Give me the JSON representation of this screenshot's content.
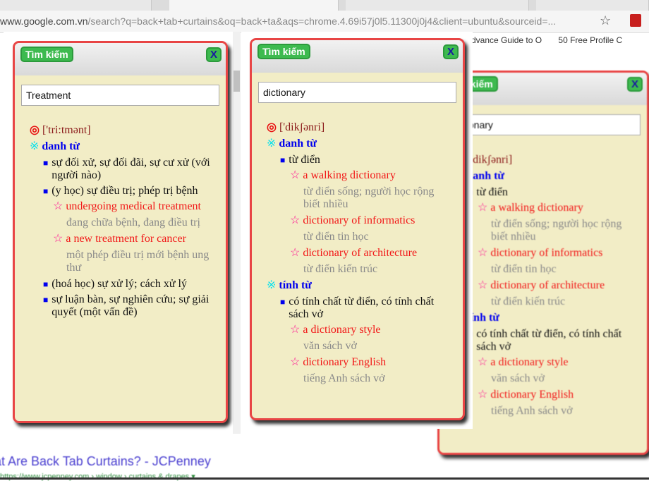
{
  "browser": {
    "url_host": "www.google.com.vn",
    "url_path": "/search?q=back+tab+curtains&oq=back+ta&aqs=chrome.4.69i57j0l5.11300j0j4&client=ubuntu&sourceid=...",
    "bookmarks": [
      "Advance Guide to O",
      "50 Free Profile C"
    ]
  },
  "search_result": {
    "title": "at Are Back Tab Curtains? - JCPenney",
    "url": "https://www.jcpenney.com › window › curtains & drapes ▾"
  },
  "popups": [
    {
      "title": "Tìm kiếm",
      "close": "X",
      "input": "Treatment",
      "phonetic": "['tri:tmənt]",
      "pos": [
        {
          "label": "danh từ",
          "senses": [
            {
              "text": "sự đối xử, sự đối đãi, sự cư xử (với người nào)",
              "examples": []
            },
            {
              "text": "(y học) sự điều trị; phép trị bệnh",
              "examples": [
                {
                  "en": "undergoing medical treatment",
                  "vi": "đang chữa bệnh, đang điều trị"
                },
                {
                  "en": "a new treatment for cancer",
                  "vi": "một phép điều trị mới bệnh ung thư"
                }
              ]
            },
            {
              "text": "(hoá học) sự xử lý; cách xử lý",
              "examples": []
            },
            {
              "text": "sự luận bàn, sự nghiên cứu; sự giải quyết (một vấn đề)",
              "examples": []
            }
          ]
        }
      ]
    },
    {
      "title": "Tìm kiếm",
      "close": "X",
      "input": "dictionary",
      "phonetic": "['dikʃənri]",
      "pos": [
        {
          "label": "danh từ",
          "senses": [
            {
              "text": "từ điển",
              "examples": [
                {
                  "en": "a walking dictionary",
                  "vi": "từ điển sống; người học rộng biết nhiều"
                },
                {
                  "en": "dictionary of informatics",
                  "vi": "từ điển tin học"
                },
                {
                  "en": "dictionary of architecture",
                  "vi": "từ điển kiến trúc"
                }
              ]
            }
          ]
        },
        {
          "label": "tính từ",
          "senses": [
            {
              "text": "có tính chất từ điển, có tính chất sách vở",
              "examples": [
                {
                  "en": "a dictionary style",
                  "vi": "văn sách vở"
                },
                {
                  "en": "dictionary English",
                  "vi": "tiếng Anh sách vở"
                }
              ]
            }
          ]
        }
      ]
    },
    {
      "title": "Tìm kiếm",
      "close": "X",
      "input": "dictionary",
      "phonetic": "['dikʃənri]",
      "pos": [
        {
          "label": "danh từ",
          "senses": [
            {
              "text": "từ điển",
              "examples": [
                {
                  "en": "a walking dictionary",
                  "vi": "từ điển sống; người học rộng biết nhiều"
                },
                {
                  "en": "dictionary of informatics",
                  "vi": "từ điển tin học"
                },
                {
                  "en": "dictionary of architecture",
                  "vi": "từ điển kiến trúc"
                }
              ]
            }
          ]
        },
        {
          "label": "tính từ",
          "senses": [
            {
              "text": "có tính chất từ điển, có tính chất sách vở",
              "examples": [
                {
                  "en": "a dictionary style",
                  "vi": "văn sách vở"
                },
                {
                  "en": "dictionary English",
                  "vi": "tiếng Anh sách vở"
                }
              ]
            }
          ]
        }
      ]
    }
  ],
  "icons": {
    "phonetic": "◎",
    "pos": "※",
    "sense": "■",
    "example": "☆",
    "bookmark_star": "☆"
  },
  "colors": {
    "border": "#e84545",
    "popup_bg": "#f2edc6",
    "button": "#3dba4f",
    "pos": "#0000ee",
    "example": "#f21818",
    "translation": "#8a8a8a"
  }
}
